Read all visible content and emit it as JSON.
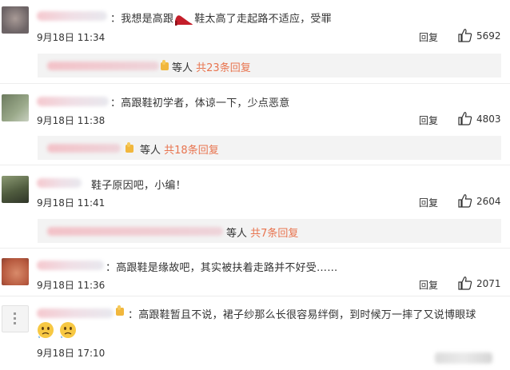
{
  "comments": [
    {
      "text": "：我想是高跟",
      "text_after": "鞋太高了走起路不适应，受罪",
      "time": "9月18日 11:34",
      "reply": "回复",
      "likes": "5692",
      "sub_reply": {
        "label": "等人",
        "link": "共23条回复"
      }
    },
    {
      "text": "：高跟鞋初学者，体谅一下，少点恶意",
      "time": "9月18日 11:38",
      "reply": "回复",
      "likes": "4803",
      "sub_reply": {
        "label": "等人",
        "link": "共18条回复"
      }
    },
    {
      "text": "鞋子原因吧，小编！",
      "time": "9月18日 11:41",
      "reply": "回复",
      "likes": "2604",
      "sub_reply": {
        "label": "等人",
        "link": "共7条回复"
      }
    },
    {
      "text": "：高跟鞋是缘故吧，其实被扶着走路并不好受……",
      "time": "9月18日 11:36",
      "reply": "回复",
      "likes": "2071"
    },
    {
      "text": "：高跟鞋暂且不说，裙子纱那么长很容易绊倒，到时候万一摔了又说博眼球",
      "time": "9月18日 17:10"
    }
  ],
  "colors": {
    "link": "#e8744f",
    "sub_bg": "#f3f3f3",
    "text": "#333333"
  },
  "icons": {
    "like": "thumbs-up-icon",
    "shoe": "high-heel-icon",
    "emoji": "worried-face-icon"
  }
}
